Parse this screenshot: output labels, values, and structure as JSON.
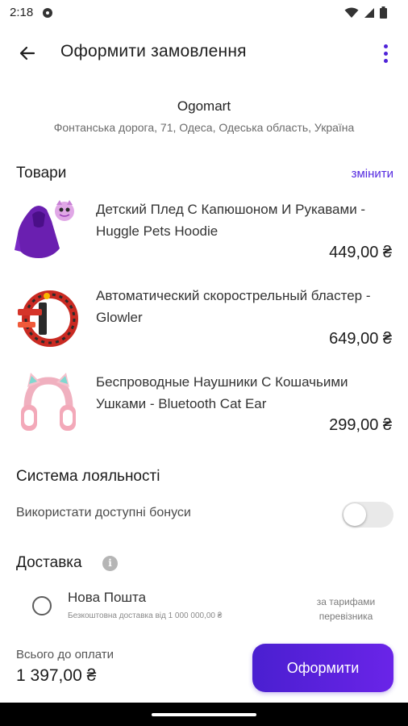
{
  "status_bar": {
    "time": "2:18",
    "icons": [
      "message-icon",
      "wifi-icon",
      "signal-icon",
      "battery-icon"
    ]
  },
  "app_bar": {
    "title": "Оформити замовлення",
    "back_icon": "arrow-left-icon",
    "menu_icon": "more-vert-icon"
  },
  "store": {
    "name": "Ogomart",
    "address": "Фонтанська дорога, 71, Одеса, Одеська область, Україна"
  },
  "goods": {
    "title": "Товари",
    "change_label": "змінити",
    "items": [
      {
        "name": "Детский Плед С Капюшоном И Рукавами - Huggle Pets Hoodie",
        "price": "449,00 ₴",
        "thumb": "purple-hoodie-image"
      },
      {
        "name": "Автоматический скорострельный бластер - Glowler",
        "price": "649,00 ₴",
        "thumb": "blaster-image"
      },
      {
        "name": "Беспроводные Наушники С Кошачьими Ушками - Bluetooth Cat Ear",
        "price": "299,00 ₴",
        "thumb": "cat-ear-headphones-image"
      }
    ]
  },
  "loyalty": {
    "title": "Система лояльності",
    "use_bonus_label": "Використати доступні бонуси",
    "use_bonus_enabled": false
  },
  "delivery": {
    "title": "Доставка",
    "info_icon": "info-icon",
    "options": [
      {
        "name": "Нова Пошта",
        "note": "Безкоштовна доставка від 1 000 000,00 ₴",
        "tariff": "за тарифами перевізника",
        "selected": false
      }
    ]
  },
  "footer": {
    "total_label": "Всього до оплати",
    "total_value": "1 397,00 ₴",
    "checkout_label": "Оформити"
  },
  "colors": {
    "accent": "#5429e0",
    "button_gradient_start": "#4a1fd0",
    "button_gradient_end": "#6a24e8",
    "toggle_off": "#e9e9e9"
  }
}
